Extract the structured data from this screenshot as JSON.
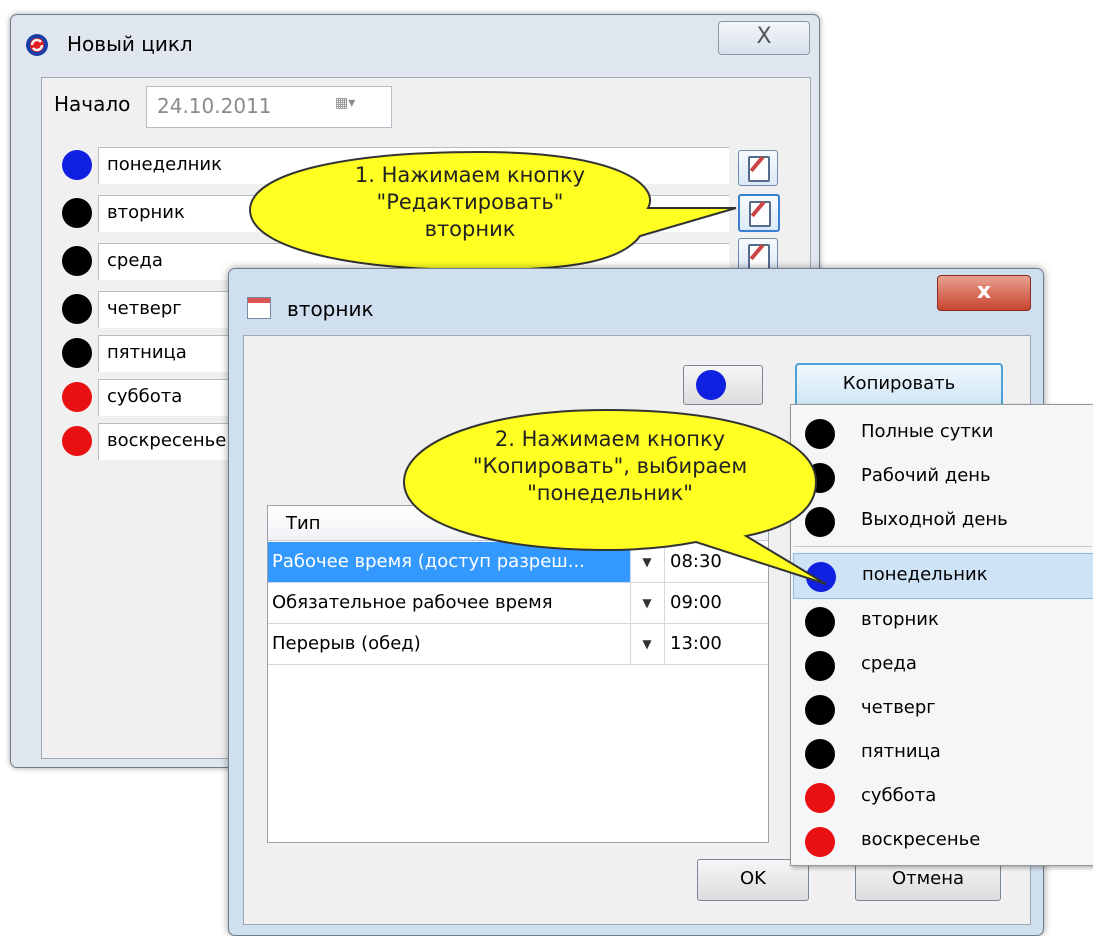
{
  "outer_window": {
    "title": "Новый цикл",
    "close_label": "X",
    "start_label": "Начало",
    "start_date": "24.10.2011",
    "date_dropdown": "▦▾",
    "days": [
      {
        "label": "понеделник",
        "color": "#1020e0"
      },
      {
        "label": "вторник",
        "color": "#000000"
      },
      {
        "label": "среда",
        "color": "#000000"
      },
      {
        "label": "четверг",
        "color": "#000000"
      },
      {
        "label": "пятница",
        "color": "#000000"
      },
      {
        "label": "суббота",
        "color": "#e81010"
      },
      {
        "label": "воскресенье",
        "color": "#e81010"
      }
    ]
  },
  "inner_dialog": {
    "title": "вторник",
    "close_label": "x",
    "copy_label": "Копировать",
    "grid": {
      "header_type": "Тип",
      "rows": [
        {
          "type": "Рабочее время (доступ разреш...",
          "time": "08:30",
          "selected": true
        },
        {
          "type": "Обязательное рабочее время",
          "time": "09:00",
          "selected": false
        },
        {
          "type": "Перерыв (обед)",
          "time": "13:00",
          "selected": false
        }
      ]
    },
    "ok_label": "OK",
    "cancel_label": "Отмена"
  },
  "copy_menu": {
    "presets": [
      {
        "label": "Полные сутки",
        "color": "#000000"
      },
      {
        "label": "Рабочий день",
        "color": "#000000"
      },
      {
        "label": "Выходной день",
        "color": "#000000"
      }
    ],
    "days": [
      {
        "label": "понедельник",
        "color": "#1020e0",
        "highlighted": true
      },
      {
        "label": "вторник",
        "color": "#000000"
      },
      {
        "label": "среда",
        "color": "#000000"
      },
      {
        "label": "четверг",
        "color": "#000000"
      },
      {
        "label": "пятница",
        "color": "#000000"
      },
      {
        "label": "суббота",
        "color": "#e81010"
      },
      {
        "label": "воскресенье",
        "color": "#e81010"
      }
    ]
  },
  "callouts": {
    "step1": {
      "line1": "1. Нажимаем кнопку",
      "line2": "\"Редактировать\"",
      "line3": "вторник"
    },
    "step2": {
      "line1": "2. Нажимаем кнопку",
      "line2": "\"Копировать\", выбираем",
      "line3": "\"понедельник\""
    }
  },
  "colors": {
    "callout_fill": "#ffff22",
    "selection": "#3399ff",
    "accent": "#4aa3d6"
  }
}
